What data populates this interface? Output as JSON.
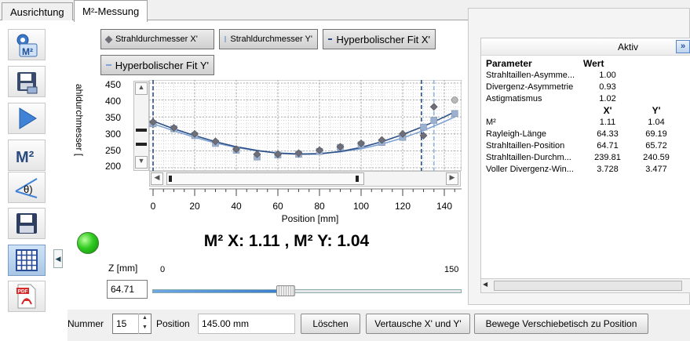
{
  "tabs": [
    {
      "label": "Ausrichtung"
    },
    {
      "label": "M²-Messung"
    }
  ],
  "toolbar": {
    "icons": [
      "m2-settings-icon",
      "save-data-icon",
      "play-icon",
      "m2-icon",
      "divergence-theta-icon",
      "save-icon",
      "grid-table-icon",
      "pdf-icon"
    ],
    "m2_label": "M²",
    "theta_label": "θ)",
    "pdf_label": "PDF"
  },
  "legend": {
    "series_x": "Strahldurchmesser X'",
    "series_y": "Strahldurchmesser Y'",
    "fit_x": "Hyperbolischer Fit X'",
    "fit_y": "Hyperbolischer Fit Y'"
  },
  "colors": {
    "series_x": "#6e6e78",
    "series_y": "#9cb0d0",
    "fit_x": "#2b4f86",
    "fit_y": "#7fa3d4",
    "led": "#2fcb20"
  },
  "chart_data": {
    "type": "scatter",
    "xlabel": "Position [mm]",
    "ylabel": "ahldurchmesser [",
    "xlim": [
      0,
      145
    ],
    "ylim": [
      200,
      450
    ],
    "x_ticks": [
      0,
      20,
      40,
      60,
      80,
      100,
      120,
      140
    ],
    "y_ticks": [
      200,
      250,
      300,
      350,
      400,
      450
    ],
    "grid": true,
    "series": [
      {
        "name": "Strahldurchmesser X'",
        "x": [
          0,
          10,
          20,
          30,
          40,
          50,
          60,
          70,
          80,
          90,
          100,
          110,
          120,
          130,
          135,
          145
        ],
        "values": [
          335,
          318,
          300,
          278,
          255,
          240,
          240,
          243,
          252,
          262,
          272,
          282,
          300,
          295,
          380,
          400
        ]
      },
      {
        "name": "Strahldurchmesser Y'",
        "x": [
          0,
          10,
          20,
          30,
          40,
          50,
          60,
          70,
          80,
          90,
          100,
          110,
          120,
          130,
          135,
          145
        ],
        "values": [
          330,
          315,
          295,
          272,
          252,
          232,
          238,
          240,
          248,
          260,
          268,
          275,
          290,
          320,
          340,
          360
        ]
      },
      {
        "name": "Hyperbolischer Fit X'",
        "x": [
          0,
          10,
          20,
          30,
          40,
          50,
          60,
          70,
          80,
          90,
          100,
          110,
          120,
          130,
          140,
          145
        ],
        "values": [
          338,
          315,
          295,
          277,
          262,
          251,
          243,
          240,
          241,
          248,
          260,
          277,
          298,
          322,
          350,
          365
        ]
      },
      {
        "name": "Hyperbolischer Fit Y'",
        "x": [
          0,
          10,
          20,
          30,
          40,
          50,
          60,
          70,
          80,
          90,
          100,
          110,
          120,
          130,
          140,
          145
        ],
        "values": [
          330,
          309,
          290,
          273,
          260,
          250,
          244,
          241,
          242,
          247,
          256,
          270,
          288,
          310,
          336,
          350
        ]
      }
    ],
    "markers": [
      {
        "position": 0,
        "style": "dashed"
      },
      {
        "position": 129,
        "style": "dashed"
      },
      {
        "position": 135,
        "style": "dashed-light"
      }
    ]
  },
  "result_text": "M² X: 1.11 , M² Y: 1.04",
  "z": {
    "label": "Z [mm]",
    "value": "64.71",
    "slider_min": "0",
    "slider_max": "150",
    "slider_value": 64.71
  },
  "params": {
    "header_aktiv": "Aktiv",
    "header_param": "Parameter",
    "header_wert": "Wert",
    "rows_single": [
      {
        "name": "Strahltaillen-Asymme...",
        "value": "1.00"
      },
      {
        "name": "Divergenz-Asymmetrie",
        "value": "0.93"
      },
      {
        "name": "Astigmatismus",
        "value": "1.02"
      }
    ],
    "col_x": "X'",
    "col_y": "Y'",
    "rows_xy": [
      {
        "name": "M²",
        "x": "1.11",
        "y": "1.04"
      },
      {
        "name": "Rayleigh-Länge",
        "x": "64.33",
        "y": "69.19"
      },
      {
        "name": "Strahltaillen-Position",
        "x": "64.71",
        "y": "65.72"
      },
      {
        "name": "Strahltaillen-Durchm...",
        "x": "239.81",
        "y": "240.59"
      },
      {
        "name": "Voller Divergenz-Win...",
        "x": "3.728",
        "y": "3.477"
      }
    ]
  },
  "bottom": {
    "nummer_label": "Nummer",
    "nummer_value": "15",
    "position_label": "Position",
    "position_value": "145.00 mm",
    "delete_button": "Löschen",
    "swap_button": "Vertausche X' und Y'",
    "move_button": "Bewege Verschiebetisch zu Position"
  }
}
